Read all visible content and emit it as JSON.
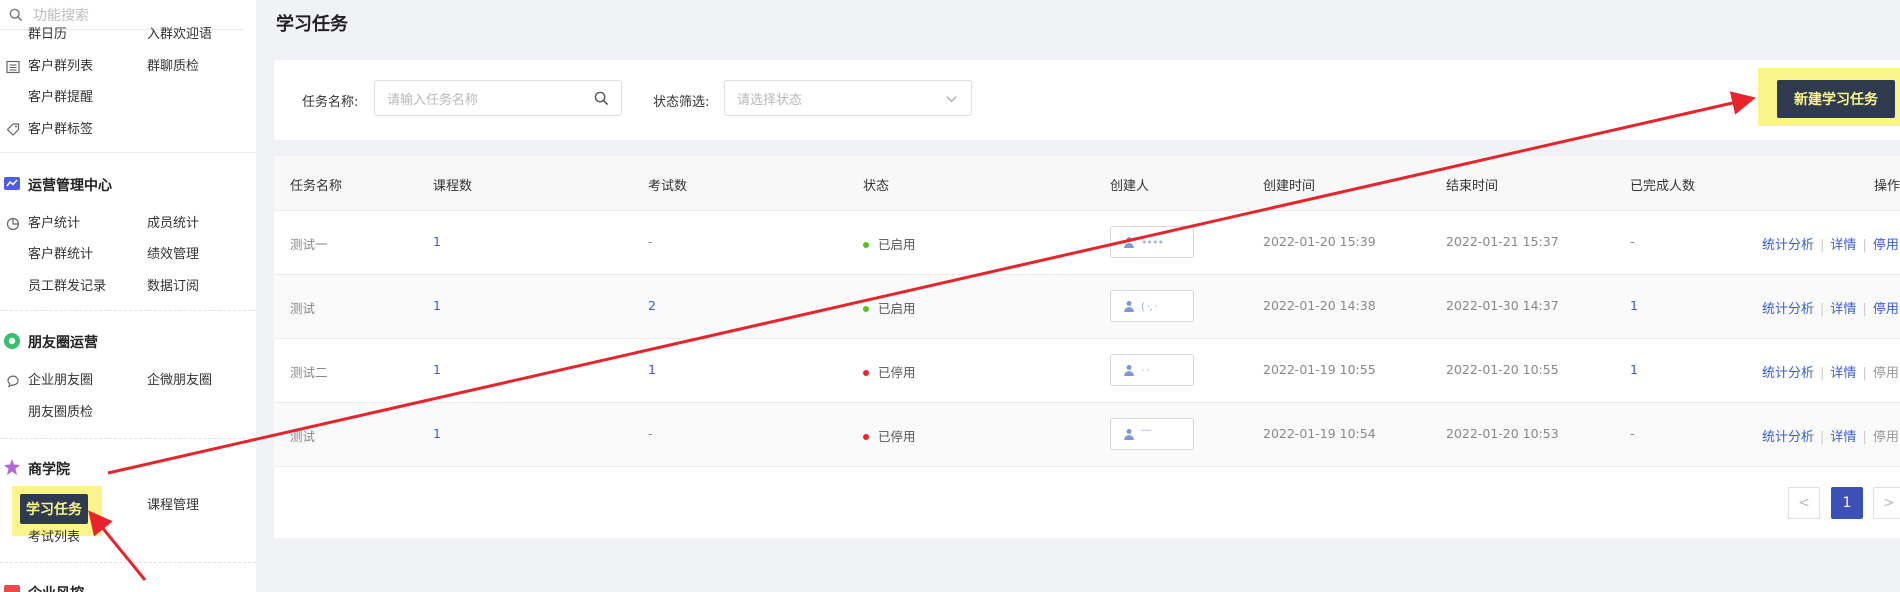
{
  "sidebar": {
    "search_placeholder": "功能搜索",
    "partial_top_left": "群日历",
    "partial_top_right": "入群欢迎语",
    "customer_group_items": [
      {
        "label": "客户群列表",
        "icon": "list-icon"
      },
      {
        "label": "群聊质检"
      },
      {
        "label": "客户群提醒"
      },
      {
        "label": "客户群标签",
        "icon": "tag-icon"
      }
    ],
    "ops_center": {
      "title": "运营管理中心",
      "items": [
        "客户统计",
        "成员统计",
        "客户群统计",
        "绩效管理",
        "员工群发记录",
        "数据订阅"
      ]
    },
    "moments": {
      "title": "朋友圈运营",
      "items": [
        "企业朋友圈",
        "企微朋友圈",
        "朋友圈质检"
      ]
    },
    "academy": {
      "title": "商学院",
      "active_item": "学习任务",
      "items": [
        "课程管理",
        "考试列表"
      ]
    },
    "partial_bottom_group": "企业风控"
  },
  "main": {
    "page_title": "学习任务",
    "filter": {
      "name_label": "任务名称:",
      "name_placeholder": "请输入任务名称",
      "status_label": "状态筛选:",
      "status_placeholder": "请选择状态"
    },
    "new_button": "新建学习任务",
    "table": {
      "headers": [
        "任务名称",
        "课程数",
        "考试数",
        "状态",
        "创建人",
        "创建时间",
        "结束时间",
        "已完成人数",
        "操作"
      ],
      "rows": [
        {
          "name": "测试一",
          "courses": "1",
          "exams": "-",
          "status": "已启用",
          "status_color": "#52c41a",
          "creator": "••••",
          "created": "2022-01-20 15:39",
          "ends": "2022-01-21 15:37",
          "completed": "-",
          "actions": [
            "统计分析",
            "详情",
            "停用"
          ]
        },
        {
          "name": "测试",
          "courses": "1",
          "exams": "2",
          "status": "已启用",
          "status_color": "#52c41a",
          "creator": "( ·, ·",
          "created": "2022-01-20 14:38",
          "ends": "2022-01-30 14:37",
          "completed": "1",
          "actions": [
            "统计分析",
            "详情",
            "停用"
          ]
        },
        {
          "name": "测试二",
          "courses": "1",
          "exams": "1",
          "status": "已停用",
          "status_color": "#f5222d",
          "creator": "· ·",
          "created": "2022-01-19 10:55",
          "ends": "2022-01-20 10:55",
          "completed": "1",
          "actions": [
            "统计分析",
            "详情",
            "停用"
          ]
        },
        {
          "name": "测试",
          "courses": "1",
          "exams": "-",
          "status": "已停用",
          "status_color": "#f5222d",
          "creator": "‾‾",
          "created": "2022-01-19 10:54",
          "ends": "2022-01-20 10:53",
          "completed": "-",
          "actions": [
            "统计分析",
            "详情",
            "停用"
          ]
        }
      ]
    },
    "pagination": {
      "prev": "<",
      "current": "1",
      "next": ">"
    }
  },
  "colors": {
    "highlight_yellow": "#fbf48a",
    "dark_button": "#2e3b4e",
    "link_blue": "#3b5bdb",
    "arrow_red": "#e8232b",
    "pager_active": "#3d50b6"
  }
}
